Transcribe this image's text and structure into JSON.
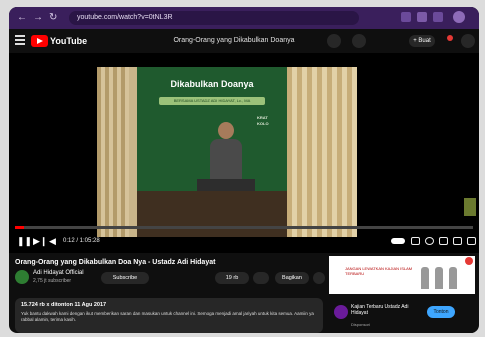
{
  "browser": {
    "back_icon": "arrow-left-icon",
    "url": "youtube.com/watch?v=0tNL3R",
    "nav_symbols": [
      "←",
      "→",
      "↻"
    ]
  },
  "header": {
    "logo_text": "YouTube",
    "title": "Orang-Orang yang Dikabulkan Doanya",
    "create_label": "+ Buat"
  },
  "video": {
    "backdrop_title": "Dikabulkan Doanya",
    "backdrop_sub": "BERSAMA USTADZ ADI HIDAYAT, Lc., MA",
    "backdrop_right": "KRAT\nKOLO",
    "progress": 0.02,
    "time": "0:12 / 1:05:28"
  },
  "below": {
    "title": "Orang-Orang yang Dikabulkan Doa Nya - Ustadz Adi Hidayat",
    "channel_name": "Adi Hidayat Official",
    "channel_subs": "2,75 jt subscriber",
    "subscribe_label": "Subscribe",
    "like_label": "19 rb",
    "share_label": "Bagikan",
    "desc_meta": "15.724 rb x ditonton  11 Agu 2017",
    "desc_text": "Yuk bantu dakwah kami dengan ikut memberikan saran dan masukan untuk channel ini. Semoga menjadi amal jariyah untuk kita semua. Aamiin ya rabbal alamin, terima kasih."
  },
  "ad": {
    "text": "JANGAN LEWATKAN KAJIAN ISLAM TERBARU"
  },
  "recommend": {
    "title": "Kajian Terbaru Ustadz Adi Hidayat",
    "sub": "Disponsori",
    "button": "Tonton"
  },
  "colors": {
    "brand_red": "#ff0000",
    "subscribe_blue": "#3ea6ff",
    "browser_purple": "#3a1f5c"
  }
}
